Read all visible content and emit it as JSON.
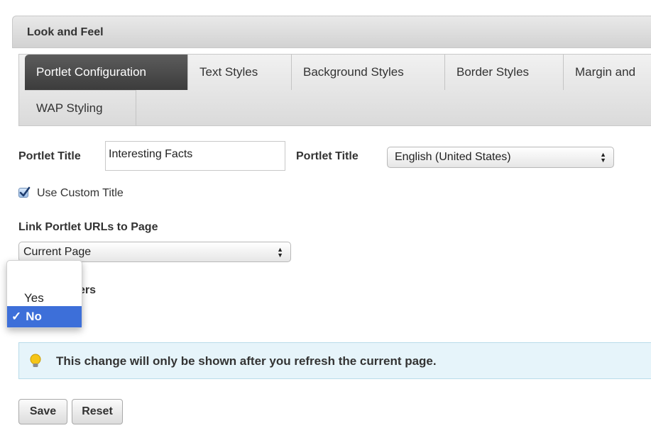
{
  "panel": {
    "title": "Look and Feel"
  },
  "tabs": [
    {
      "label": "Portlet Configuration",
      "active": true
    },
    {
      "label": "Text Styles"
    },
    {
      "label": "Background Styles"
    },
    {
      "label": "Border Styles"
    },
    {
      "label": "Margin and"
    },
    {
      "label": "WAP Styling"
    }
  ],
  "form": {
    "portlet_title_label": "Portlet Title",
    "portlet_title_value": "Interesting Facts",
    "language_label": "Portlet Title",
    "language_value": "English (United States)",
    "use_custom_title_label": "Use Custom Title",
    "use_custom_title_checked": true,
    "link_urls_label": "Link Portlet URLs to Page",
    "link_urls_value": "Current Page",
    "show_borders_label_visible": "rders"
  },
  "dropdown": {
    "options": [
      {
        "label": "Yes",
        "selected": false
      },
      {
        "label": "No",
        "selected": true,
        "check": "✓"
      }
    ]
  },
  "alert": {
    "message": "This change will only be shown after you refresh the current page."
  },
  "buttons": {
    "save": "Save",
    "reset": "Reset"
  },
  "icons": {
    "checkbox": "checkmark-icon",
    "select_arrows": "updown-arrows-icon",
    "alert": "lightbulb-icon"
  },
  "colors": {
    "active_tab": "#4a4a4a",
    "highlight": "#3d6fd9",
    "alert_bg": "#e6f4fa"
  }
}
